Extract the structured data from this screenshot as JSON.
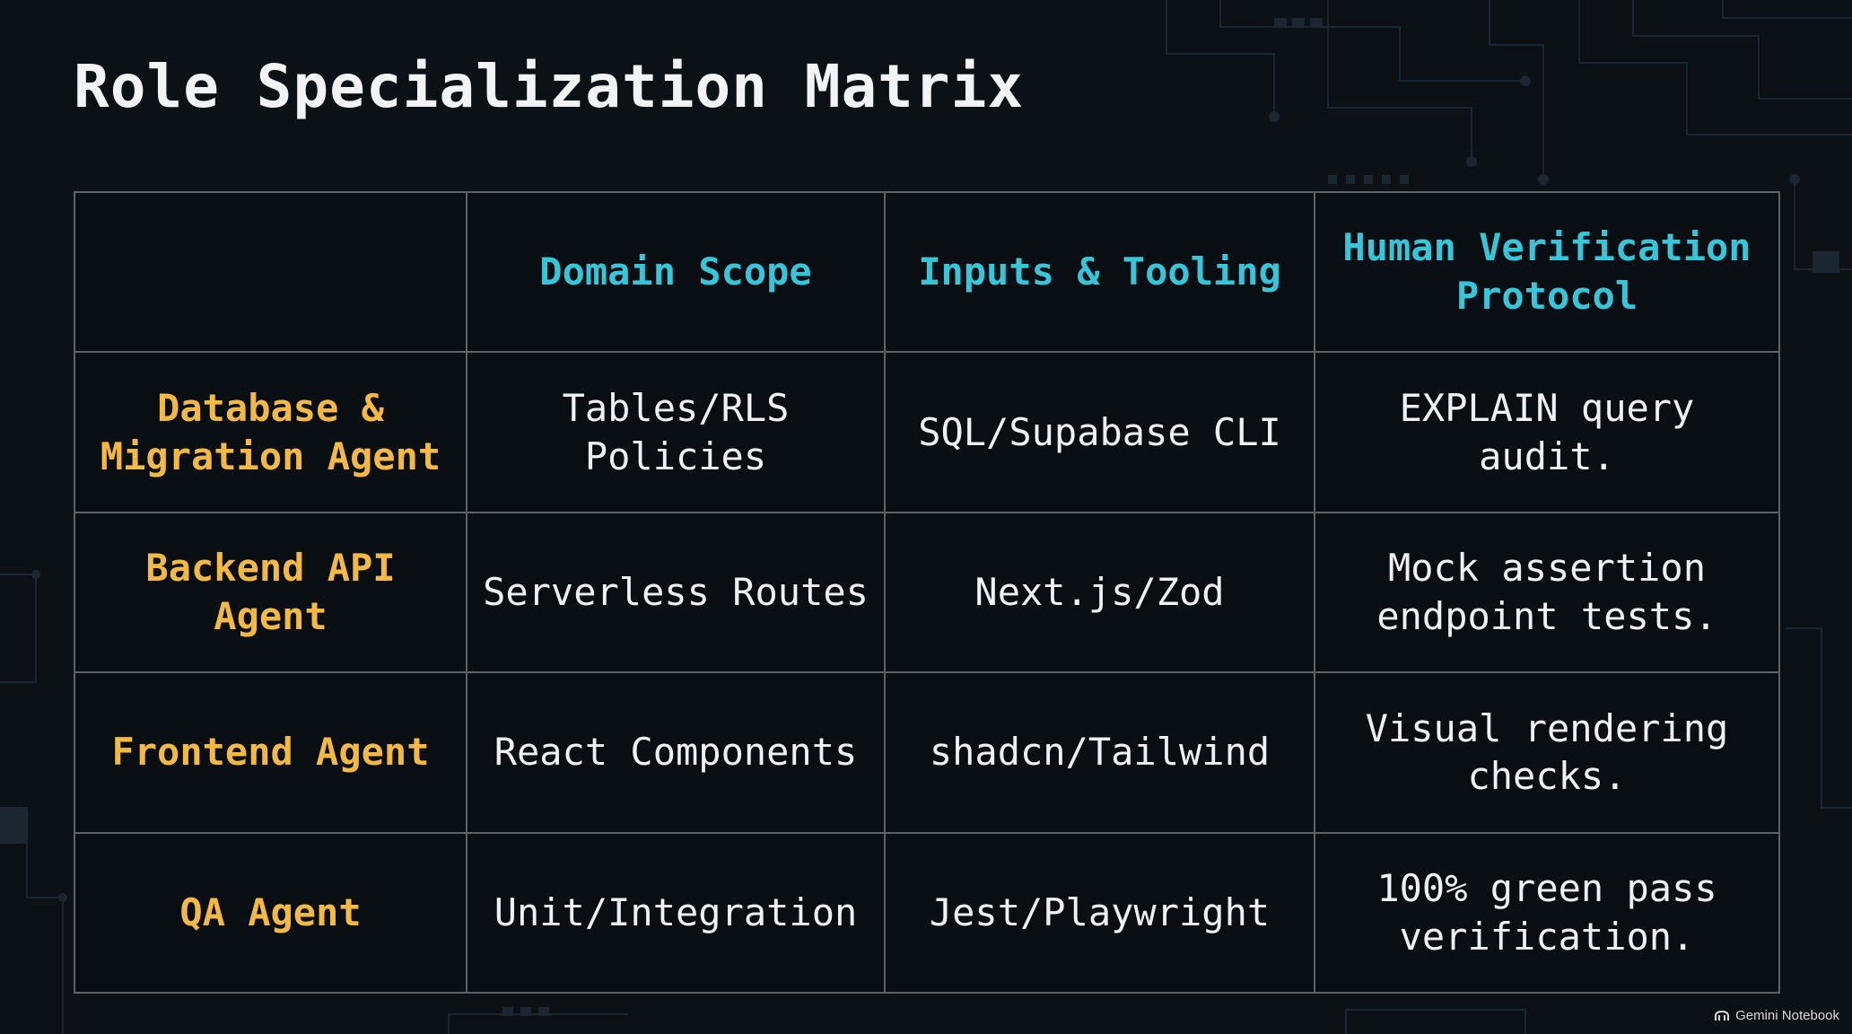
{
  "slide": {
    "title": "Role Specialization Matrix"
  },
  "matrix": {
    "headers": [
      "",
      "Domain Scope",
      "Inputs & Tooling",
      "Human Verification Protocol"
    ],
    "rows": [
      {
        "role": "Database & Migration Agent",
        "domain_scope": "Tables/RLS Policies",
        "inputs_tooling": "SQL/Supabase CLI",
        "verification": "EXPLAIN query audit."
      },
      {
        "role": "Backend API Agent",
        "domain_scope": "Serverless Routes",
        "inputs_tooling": "Next.js/Zod",
        "verification": "Mock assertion endpoint tests."
      },
      {
        "role": "Frontend Agent",
        "domain_scope": "React Components",
        "inputs_tooling": "shadcn/Tailwind",
        "verification": "Visual rendering checks."
      },
      {
        "role": "QA Agent",
        "domain_scope": "Unit/Integration",
        "inputs_tooling": "Jest/Playwright",
        "verification": "100% green pass verification."
      }
    ]
  },
  "watermark": {
    "text": "Gemini Notebook",
    "icon": "notebook-icon"
  },
  "colors": {
    "background": "#0c1116",
    "header_text": "#36c6d9",
    "role_text": "#f4b942",
    "cell_text": "#eef1f3",
    "grid_line": "#5b6268"
  }
}
